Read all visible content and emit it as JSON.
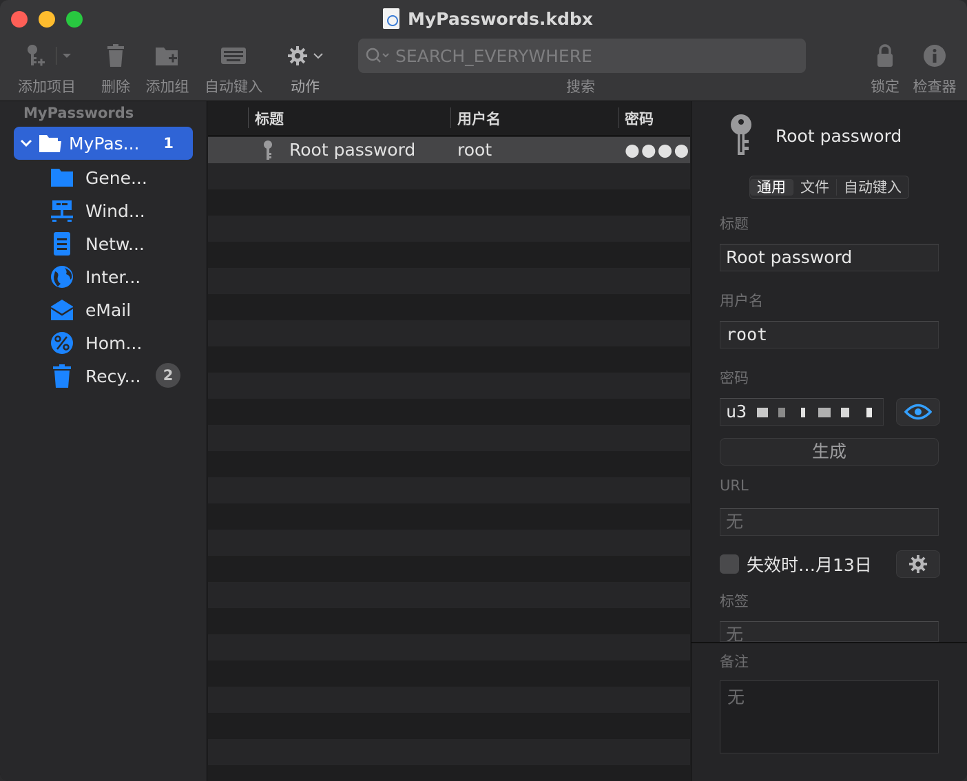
{
  "window": {
    "title": "MyPasswords.kdbx"
  },
  "toolbar": {
    "add_entry": "添加项目",
    "delete": "删除",
    "add_group": "添加组",
    "autotype": "自动键入",
    "actions": "动作",
    "search_label": "搜索",
    "search_placeholder": "SEARCH_EVERYWHERE",
    "lock": "锁定",
    "inspector": "检查器"
  },
  "sidebar": {
    "header": "MyPasswords",
    "root": {
      "label": "MyPas...",
      "count": "1"
    },
    "groups": [
      {
        "label": "Gene...",
        "icon": "folder-icon"
      },
      {
        "label": "Wind...",
        "icon": "network-windows-icon"
      },
      {
        "label": "Netw...",
        "icon": "server-icon"
      },
      {
        "label": "Inter...",
        "icon": "globe-icon"
      },
      {
        "label": "eMail",
        "icon": "envelope-icon"
      },
      {
        "label": "Hom...",
        "icon": "percent-icon"
      },
      {
        "label": "Recy...",
        "icon": "trash-icon",
        "badge": "2"
      }
    ]
  },
  "list": {
    "columns": {
      "title": "标题",
      "username": "用户名",
      "password": "密码"
    },
    "rows": [
      {
        "title": "Root password",
        "username": "root",
        "password": "●●●●●●"
      }
    ]
  },
  "inspector": {
    "title": "Root password",
    "tabs": [
      "通用",
      "文件",
      "自动键入"
    ],
    "labels": {
      "title": "标题",
      "username": "用户名",
      "password": "密码",
      "url": "URL",
      "tags": "标签",
      "notes": "备注"
    },
    "values": {
      "title": "Root password",
      "username": "root",
      "password_prefix": "u3",
      "url": "无",
      "tags": "无",
      "notes": "无"
    },
    "generate_button": "生成",
    "expiry_label": "失效时…月13日"
  },
  "colors": {
    "accent": "#2f64d6",
    "eye": "#34a0ff",
    "folder": "#1b84ff"
  }
}
